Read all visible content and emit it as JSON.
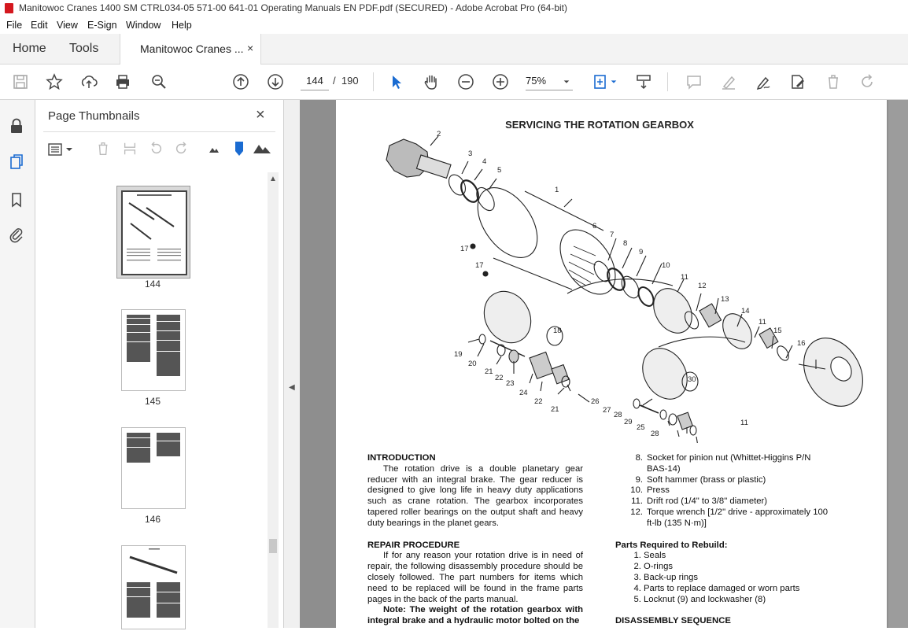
{
  "window": {
    "title": "Manitowoc Cranes 1400 SM CTRL034-05 571-00 641-01 Operating Manuals EN PDF.pdf (SECURED) - Adobe Acrobat Pro (64-bit)"
  },
  "menu": [
    "File",
    "Edit",
    "View",
    "E-Sign",
    "Window",
    "Help"
  ],
  "tabs": {
    "home": "Home",
    "tools": "Tools",
    "doc": "Manitowoc Cranes ...",
    "close": "×"
  },
  "nav": {
    "current_page": "144",
    "of": "/",
    "total": "190",
    "zoom": "75%"
  },
  "panel": {
    "title": "Page Thumbnails",
    "close": "×",
    "thumbnails": [
      {
        "label": "144",
        "selected": true
      },
      {
        "label": "145"
      },
      {
        "label": "146"
      },
      {
        "label": ""
      }
    ]
  },
  "document": {
    "title": "SERVICING THE ROTATION GEARBOX",
    "callouts": [
      "1",
      "2",
      "3",
      "4",
      "5",
      "6",
      "7",
      "8",
      "9",
      "10",
      "11",
      "11",
      "11",
      "12",
      "13",
      "14",
      "15",
      "16",
      "17",
      "17",
      "18",
      "19",
      "20",
      "21",
      "21",
      "22",
      "22",
      "23",
      "24",
      "25",
      "26",
      "27",
      "28",
      "28",
      "29",
      "30"
    ],
    "intro_heading": "INTRODUCTION",
    "intro_text": "The rotation drive is a double planetary gear reducer with an integral brake. The gear reducer is designed to give long life in heavy duty applications such as crane rotation. The gearbox incorporates tapered roller bearings on the output shaft and heavy duty bearings in the planet gears.",
    "repair_heading": "REPAIR PROCEDURE",
    "repair_text": "If for any reason your rotation drive is in need of repair, the following disassembly procedure should be closely followed. The part numbers for items which need to be replaced will be found in the frame parts pages in the back of the parts manual.",
    "note_text": "Note: The weight of the rotation gearbox with integral brake and a hydraulic motor bolted on the",
    "tools_list": [
      {
        "n": "8.",
        "t": "Socket for pinion nut (Whittet-Higgins P/N BAS-14)"
      },
      {
        "n": "9.",
        "t": "Soft hammer (brass or plastic)"
      },
      {
        "n": "10.",
        "t": "Press"
      },
      {
        "n": "11.",
        "t": "Drift rod (1/4\" to 3/8\" diameter)"
      },
      {
        "n": "12.",
        "t": "Torque wrench [1/2\" drive - approximately 100 ft-lb (135 N·m)]"
      }
    ],
    "parts_heading": "Parts Required to Rebuild:",
    "parts_list": [
      "Seals",
      "O-rings",
      "Back-up rings",
      "Parts to replace damaged or worn parts",
      "Locknut (9) and lockwasher (8)"
    ],
    "disassembly_heading": "DISASSEMBLY SEQUENCE"
  }
}
